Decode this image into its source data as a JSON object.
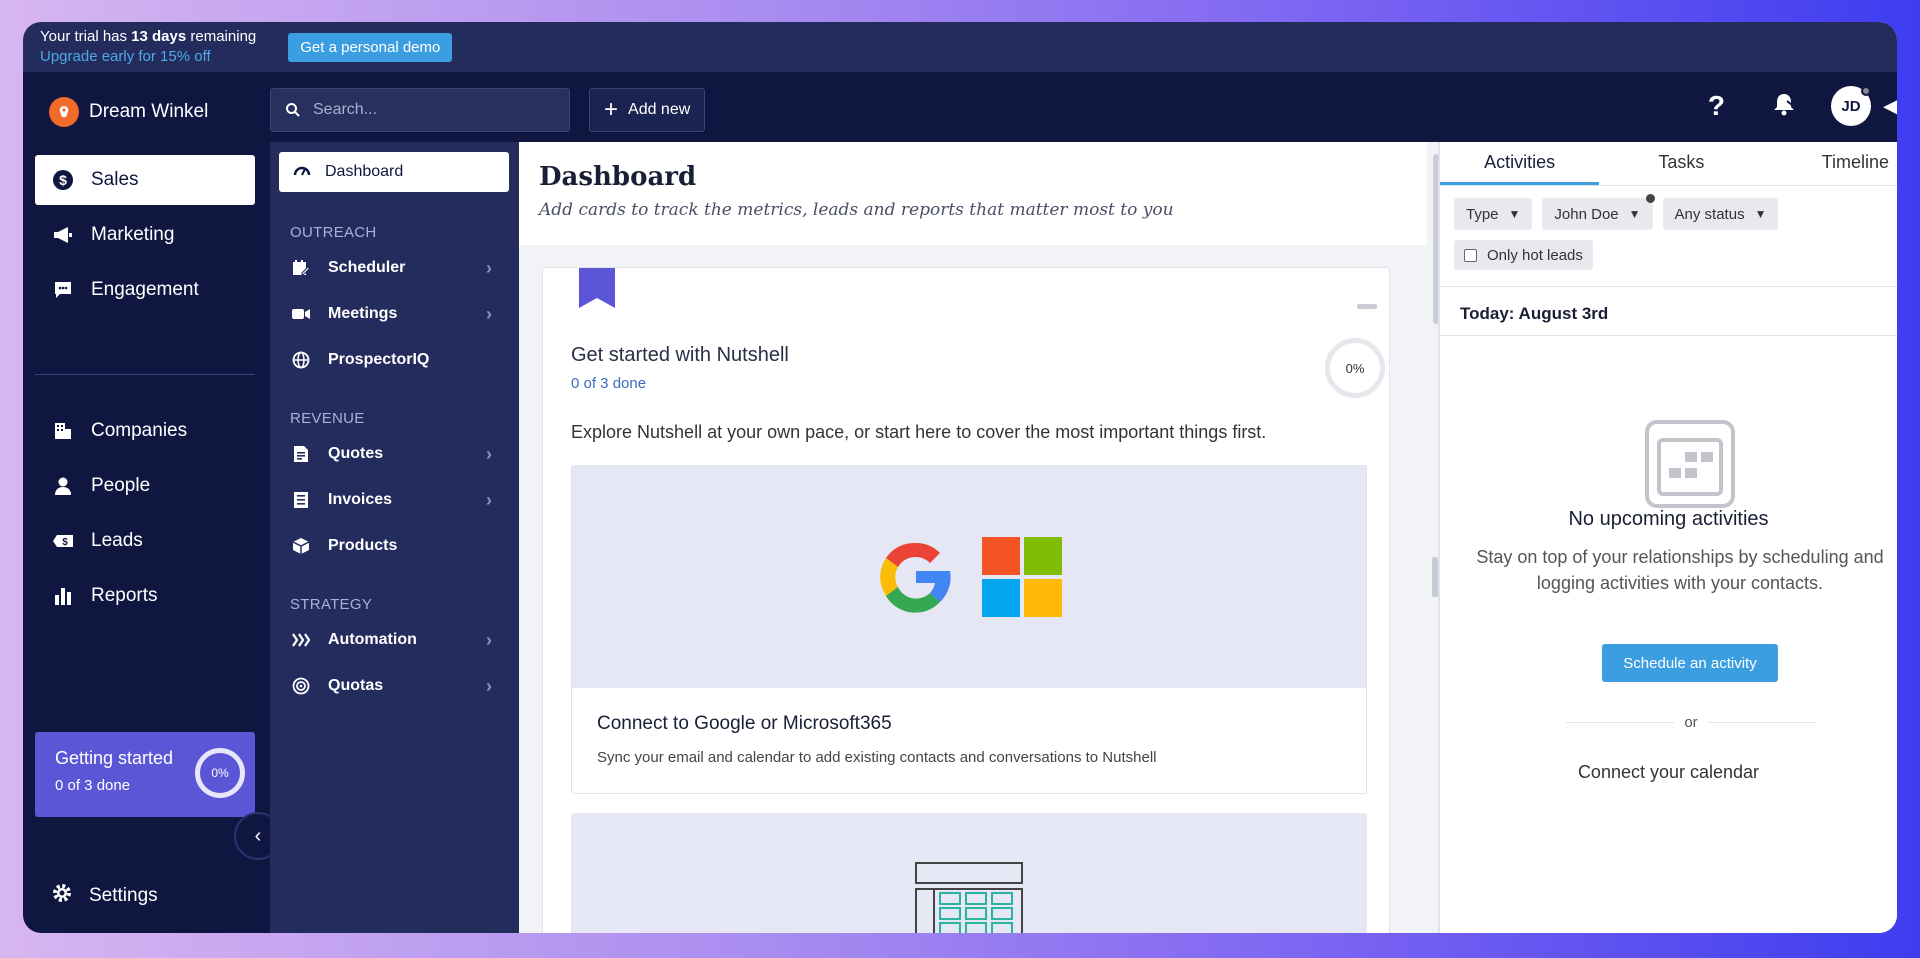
{
  "trial": {
    "prefix": "Your trial has ",
    "days": "13 days",
    "suffix": " remaining",
    "upgrade": "Upgrade early for 15% off",
    "demo_button": "Get a personal demo"
  },
  "topnav": {
    "brand": "Dream Winkel",
    "search_placeholder": "Search...",
    "add_new": "Add new",
    "avatar_initials": "JD"
  },
  "sidebar": {
    "items": [
      {
        "label": "Sales",
        "icon": "dollar-icon",
        "active": true
      },
      {
        "label": "Marketing",
        "icon": "megaphone-icon"
      },
      {
        "label": "Engagement",
        "icon": "chat-icon"
      },
      {
        "label": "Companies",
        "icon": "building-icon"
      },
      {
        "label": "People",
        "icon": "person-icon"
      },
      {
        "label": "Leads",
        "icon": "lead-icon"
      },
      {
        "label": "Reports",
        "icon": "bar-chart-icon"
      }
    ],
    "getting_started": {
      "title": "Getting started",
      "progress": "0 of 3 done",
      "percent": "0%"
    },
    "settings": "Settings"
  },
  "subnav": {
    "dashboard": "Dashboard",
    "sections": [
      {
        "title": "OUTREACH",
        "items": [
          {
            "label": "Scheduler",
            "icon": "calendar-edit-icon",
            "has_children": true
          },
          {
            "label": "Meetings",
            "icon": "video-icon",
            "has_children": true
          },
          {
            "label": "ProspectorIQ",
            "icon": "globe-icon",
            "has_children": false
          }
        ]
      },
      {
        "title": "REVENUE",
        "items": [
          {
            "label": "Quotes",
            "icon": "quote-doc-icon",
            "has_children": true
          },
          {
            "label": "Invoices",
            "icon": "invoice-icon",
            "has_children": true
          },
          {
            "label": "Products",
            "icon": "box-icon",
            "has_children": false
          }
        ]
      },
      {
        "title": "STRATEGY",
        "items": [
          {
            "label": "Automation",
            "icon": "automation-icon",
            "has_children": true
          },
          {
            "label": "Quotas",
            "icon": "target-icon",
            "has_children": true
          }
        ]
      }
    ]
  },
  "main": {
    "title": "Dashboard",
    "subtitle": "Add cards to track the metrics, leads and reports that matter most to you",
    "card": {
      "title": "Get started with Nutshell",
      "progress": "0 of 3 done",
      "percent": "0%",
      "description": "Explore Nutshell at your own pace, or start here to cover the most important things first.",
      "step1_title": "Connect to Google or Microsoft365",
      "step1_desc": "Sync your email and calendar to add existing contacts and conversations to Nutshell"
    }
  },
  "panel": {
    "tabs": [
      "Activities",
      "Tasks",
      "Timeline"
    ],
    "active_tab": "Activities",
    "filters": [
      "Type",
      "John Doe",
      "Any status"
    ],
    "hot_leads": "Only hot leads",
    "today": "Today: August 3rd",
    "empty_title": "No upcoming activities",
    "empty_desc": "Stay on top of your relationships by scheduling and logging activities with your contacts.",
    "schedule_button": "Schedule an activity",
    "or": "or",
    "connect_calendar": "Connect your calendar"
  },
  "colors": {
    "nav_dark": "#0f1640",
    "subnav": "#232c5c",
    "accent_blue": "#3a9ee0",
    "getting_started": "#5a56d6",
    "brand_orange": "#f26a2a"
  }
}
